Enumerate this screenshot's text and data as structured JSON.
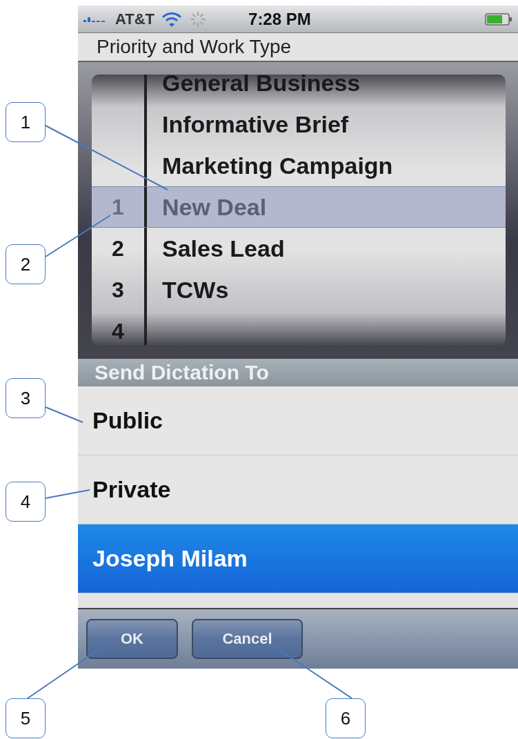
{
  "status_bar": {
    "carrier": "AT&T",
    "time": "7:28 PM"
  },
  "title": "Priority and Work Type",
  "picker": {
    "rows": [
      {
        "label": "General Business",
        "selected": false
      },
      {
        "label": "Informative Brief",
        "selected": false
      },
      {
        "label": "Marketing Campaign",
        "selected": false
      },
      {
        "number": "1",
        "label": "New Deal",
        "selected": true
      },
      {
        "number": "2",
        "label": "Sales Lead",
        "selected": false
      },
      {
        "number": "3",
        "label": "TCWs",
        "selected": false
      },
      {
        "number": "4",
        "selected": false
      }
    ]
  },
  "section_header": "Send Dictation To",
  "recipients": [
    {
      "label": "Public",
      "selected": false
    },
    {
      "label": "Private",
      "selected": false
    },
    {
      "label": "Joseph Milam",
      "selected": true
    }
  ],
  "buttons": [
    "OK",
    "Cancel"
  ],
  "callouts": [
    {
      "label": "1"
    },
    {
      "label": "2"
    },
    {
      "label": "3"
    },
    {
      "label": "4"
    },
    {
      "label": "5"
    },
    {
      "label": "6"
    }
  ]
}
